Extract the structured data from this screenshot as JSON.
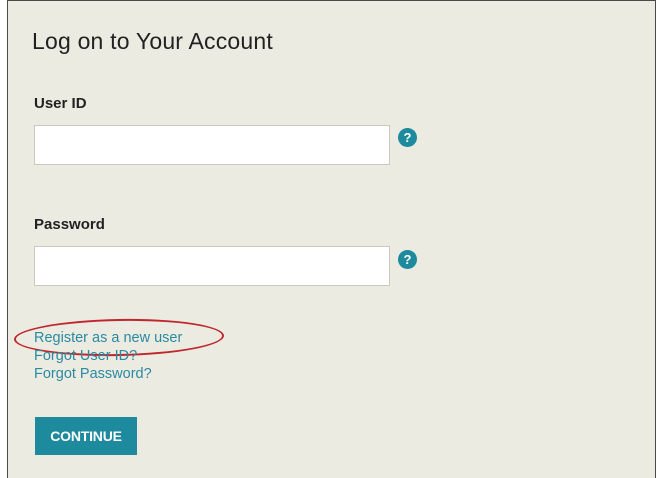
{
  "form": {
    "title": "Log on to Your Account",
    "userid_label": "User ID",
    "userid_value": "",
    "password_label": "Password",
    "password_value": "",
    "help_glyph": "?",
    "continue_label": "CONTINUE"
  },
  "links": [
    {
      "label": "Register as a new user"
    },
    {
      "label": "Forgot User ID?"
    },
    {
      "label": "Forgot Password?"
    }
  ],
  "colors": {
    "accent": "#1d8a9e",
    "link": "#2a8aa0",
    "annotation": "#c0262e",
    "panel_bg": "#ebebe2"
  },
  "icons": {
    "help": "help-question-icon"
  }
}
